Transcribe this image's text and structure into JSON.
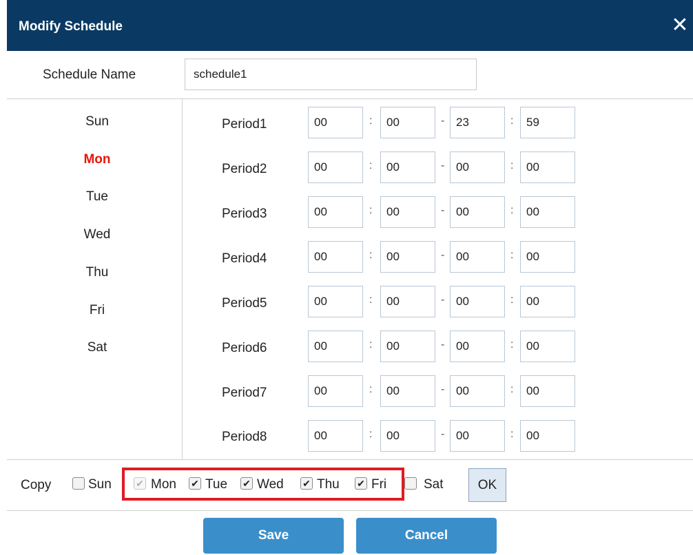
{
  "dialog": {
    "title": "Modify Schedule",
    "close_icon": "close-icon",
    "colors": {
      "titlebar": "#0a3a63",
      "active_day": "#e8160c",
      "button": "#3a8fca",
      "highlight": "#e01b24"
    }
  },
  "schedule": {
    "name_label": "Schedule Name",
    "name_value": "schedule1"
  },
  "days": [
    "Sun",
    "Mon",
    "Tue",
    "Wed",
    "Thu",
    "Fri",
    "Sat"
  ],
  "active_day": "Mon",
  "periods": [
    {
      "label": "Period1",
      "start_h": "00",
      "start_m": "00",
      "end_h": "23",
      "end_m": "59"
    },
    {
      "label": "Period2",
      "start_h": "00",
      "start_m": "00",
      "end_h": "00",
      "end_m": "00"
    },
    {
      "label": "Period3",
      "start_h": "00",
      "start_m": "00",
      "end_h": "00",
      "end_m": "00"
    },
    {
      "label": "Period4",
      "start_h": "00",
      "start_m": "00",
      "end_h": "00",
      "end_m": "00"
    },
    {
      "label": "Period5",
      "start_h": "00",
      "start_m": "00",
      "end_h": "00",
      "end_m": "00"
    },
    {
      "label": "Period6",
      "start_h": "00",
      "start_m": "00",
      "end_h": "00",
      "end_m": "00"
    },
    {
      "label": "Period7",
      "start_h": "00",
      "start_m": "00",
      "end_h": "00",
      "end_m": "00"
    },
    {
      "label": "Period8",
      "start_h": "00",
      "start_m": "00",
      "end_h": "00",
      "end_m": "00"
    }
  ],
  "separators": {
    "time": ":",
    "range": "-"
  },
  "copy": {
    "label": "Copy",
    "options": [
      {
        "day": "Sun",
        "checked": false,
        "disabled": false
      },
      {
        "day": "Mon",
        "checked": true,
        "disabled": true
      },
      {
        "day": "Tue",
        "checked": true,
        "disabled": false
      },
      {
        "day": "Wed",
        "checked": true,
        "disabled": false
      },
      {
        "day": "Thu",
        "checked": true,
        "disabled": false
      },
      {
        "day": "Fri",
        "checked": true,
        "disabled": false
      },
      {
        "day": "Sat",
        "checked": false,
        "disabled": false
      }
    ],
    "ok_label": "OK"
  },
  "buttons": {
    "save": "Save",
    "cancel": "Cancel"
  }
}
